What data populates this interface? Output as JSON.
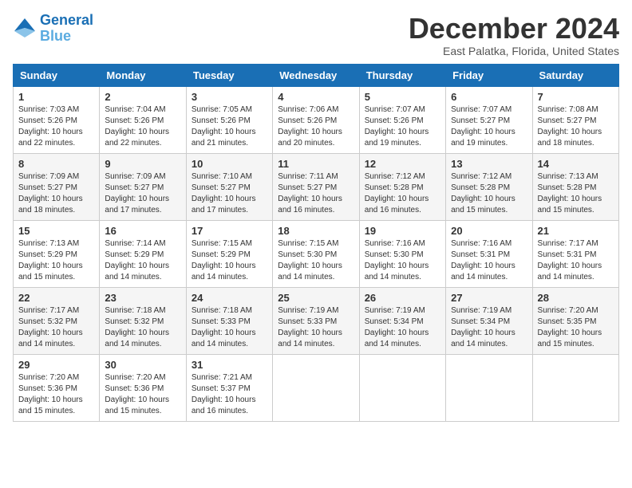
{
  "logo": {
    "line1": "General",
    "line2": "Blue"
  },
  "title": "December 2024",
  "subtitle": "East Palatka, Florida, United States",
  "weekdays": [
    "Sunday",
    "Monday",
    "Tuesday",
    "Wednesday",
    "Thursday",
    "Friday",
    "Saturday"
  ],
  "weeks": [
    [
      {
        "day": "1",
        "info": "Sunrise: 7:03 AM\nSunset: 5:26 PM\nDaylight: 10 hours\nand 22 minutes."
      },
      {
        "day": "2",
        "info": "Sunrise: 7:04 AM\nSunset: 5:26 PM\nDaylight: 10 hours\nand 22 minutes."
      },
      {
        "day": "3",
        "info": "Sunrise: 7:05 AM\nSunset: 5:26 PM\nDaylight: 10 hours\nand 21 minutes."
      },
      {
        "day": "4",
        "info": "Sunrise: 7:06 AM\nSunset: 5:26 PM\nDaylight: 10 hours\nand 20 minutes."
      },
      {
        "day": "5",
        "info": "Sunrise: 7:07 AM\nSunset: 5:26 PM\nDaylight: 10 hours\nand 19 minutes."
      },
      {
        "day": "6",
        "info": "Sunrise: 7:07 AM\nSunset: 5:27 PM\nDaylight: 10 hours\nand 19 minutes."
      },
      {
        "day": "7",
        "info": "Sunrise: 7:08 AM\nSunset: 5:27 PM\nDaylight: 10 hours\nand 18 minutes."
      }
    ],
    [
      {
        "day": "8",
        "info": "Sunrise: 7:09 AM\nSunset: 5:27 PM\nDaylight: 10 hours\nand 18 minutes."
      },
      {
        "day": "9",
        "info": "Sunrise: 7:09 AM\nSunset: 5:27 PM\nDaylight: 10 hours\nand 17 minutes."
      },
      {
        "day": "10",
        "info": "Sunrise: 7:10 AM\nSunset: 5:27 PM\nDaylight: 10 hours\nand 17 minutes."
      },
      {
        "day": "11",
        "info": "Sunrise: 7:11 AM\nSunset: 5:27 PM\nDaylight: 10 hours\nand 16 minutes."
      },
      {
        "day": "12",
        "info": "Sunrise: 7:12 AM\nSunset: 5:28 PM\nDaylight: 10 hours\nand 16 minutes."
      },
      {
        "day": "13",
        "info": "Sunrise: 7:12 AM\nSunset: 5:28 PM\nDaylight: 10 hours\nand 15 minutes."
      },
      {
        "day": "14",
        "info": "Sunrise: 7:13 AM\nSunset: 5:28 PM\nDaylight: 10 hours\nand 15 minutes."
      }
    ],
    [
      {
        "day": "15",
        "info": "Sunrise: 7:13 AM\nSunset: 5:29 PM\nDaylight: 10 hours\nand 15 minutes."
      },
      {
        "day": "16",
        "info": "Sunrise: 7:14 AM\nSunset: 5:29 PM\nDaylight: 10 hours\nand 14 minutes."
      },
      {
        "day": "17",
        "info": "Sunrise: 7:15 AM\nSunset: 5:29 PM\nDaylight: 10 hours\nand 14 minutes."
      },
      {
        "day": "18",
        "info": "Sunrise: 7:15 AM\nSunset: 5:30 PM\nDaylight: 10 hours\nand 14 minutes."
      },
      {
        "day": "19",
        "info": "Sunrise: 7:16 AM\nSunset: 5:30 PM\nDaylight: 10 hours\nand 14 minutes."
      },
      {
        "day": "20",
        "info": "Sunrise: 7:16 AM\nSunset: 5:31 PM\nDaylight: 10 hours\nand 14 minutes."
      },
      {
        "day": "21",
        "info": "Sunrise: 7:17 AM\nSunset: 5:31 PM\nDaylight: 10 hours\nand 14 minutes."
      }
    ],
    [
      {
        "day": "22",
        "info": "Sunrise: 7:17 AM\nSunset: 5:32 PM\nDaylight: 10 hours\nand 14 minutes."
      },
      {
        "day": "23",
        "info": "Sunrise: 7:18 AM\nSunset: 5:32 PM\nDaylight: 10 hours\nand 14 minutes."
      },
      {
        "day": "24",
        "info": "Sunrise: 7:18 AM\nSunset: 5:33 PM\nDaylight: 10 hours\nand 14 minutes."
      },
      {
        "day": "25",
        "info": "Sunrise: 7:19 AM\nSunset: 5:33 PM\nDaylight: 10 hours\nand 14 minutes."
      },
      {
        "day": "26",
        "info": "Sunrise: 7:19 AM\nSunset: 5:34 PM\nDaylight: 10 hours\nand 14 minutes."
      },
      {
        "day": "27",
        "info": "Sunrise: 7:19 AM\nSunset: 5:34 PM\nDaylight: 10 hours\nand 14 minutes."
      },
      {
        "day": "28",
        "info": "Sunrise: 7:20 AM\nSunset: 5:35 PM\nDaylight: 10 hours\nand 15 minutes."
      }
    ],
    [
      {
        "day": "29",
        "info": "Sunrise: 7:20 AM\nSunset: 5:36 PM\nDaylight: 10 hours\nand 15 minutes."
      },
      {
        "day": "30",
        "info": "Sunrise: 7:20 AM\nSunset: 5:36 PM\nDaylight: 10 hours\nand 15 minutes."
      },
      {
        "day": "31",
        "info": "Sunrise: 7:21 AM\nSunset: 5:37 PM\nDaylight: 10 hours\nand 16 minutes."
      },
      {
        "day": "",
        "info": ""
      },
      {
        "day": "",
        "info": ""
      },
      {
        "day": "",
        "info": ""
      },
      {
        "day": "",
        "info": ""
      }
    ]
  ]
}
